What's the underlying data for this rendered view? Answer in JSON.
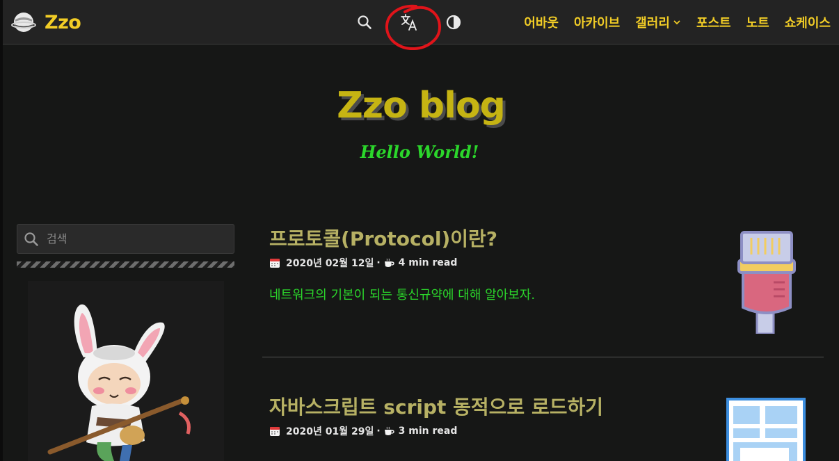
{
  "nav": {
    "brand": "Zzo",
    "links": [
      {
        "label": "어바웃",
        "dropdown": false
      },
      {
        "label": "아카이브",
        "dropdown": false
      },
      {
        "label": "갤러리",
        "dropdown": true
      },
      {
        "label": "포스트",
        "dropdown": false
      },
      {
        "label": "노트",
        "dropdown": false
      },
      {
        "label": "쇼케이스",
        "dropdown": false
      }
    ],
    "icons": [
      "search-icon",
      "translate-icon",
      "theme-toggle-icon"
    ],
    "annotation": "red-circle-around-translate-icon"
  },
  "hero": {
    "title": "Zzo blog",
    "subtitle": "Hello World!"
  },
  "sidebar": {
    "search_placeholder": "검색"
  },
  "posts": [
    {
      "title": "프로토콜(Protocol)이란?",
      "date": "2020년 02월 12일",
      "separator": "·",
      "read_time": "4 min read",
      "summary": "네트워크의 기본이 되는 통신규약에 대해 알아보자.",
      "thumbnail_icon": "ethernet-cable-icon"
    },
    {
      "title": "자바스크립트 script 동적으로 로드하기",
      "date": "2020년 01월 29일",
      "separator": "·",
      "read_time": "3 min read",
      "thumbnail_icon": "layout-window-icon"
    }
  ],
  "colors": {
    "accent": "#f2cd26",
    "title": "#c6b413",
    "subtitle": "#2bd62b",
    "post_title": "#b7b164",
    "summary": "#2bd62b",
    "background": "#161716",
    "navbar": "#232323",
    "annotation": "#e0141a"
  }
}
